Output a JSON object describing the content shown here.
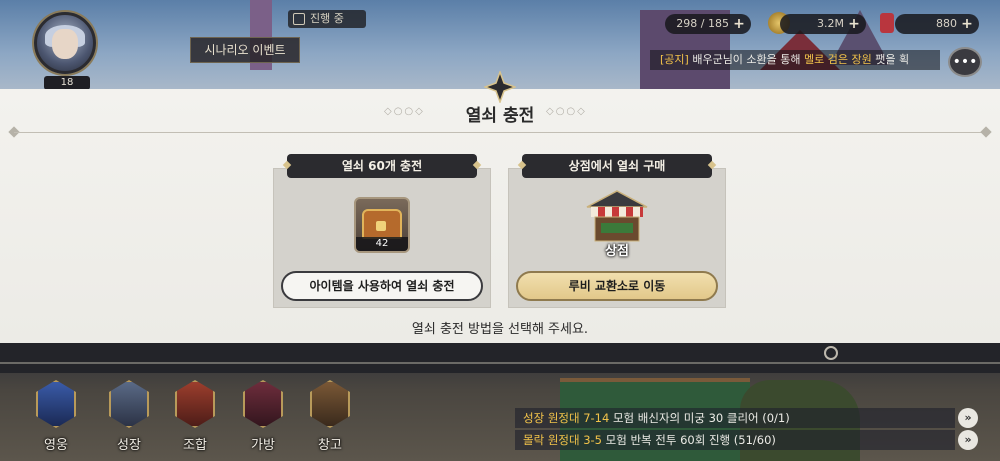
{
  "hud": {
    "player_level": "18",
    "scenario_event": "시나리오 이벤트",
    "progress_status": "진행 중",
    "energy": "298 / 185",
    "gold": "3.2M",
    "ruby": "880",
    "news_prefix": "[공지]",
    "news_text": "배우군님이 소환을 통해",
    "news_highlight": "멜로 검은 장원",
    "news_suffix": "팻을 획"
  },
  "popup": {
    "title": "열쇠 충전",
    "option_a": {
      "header": "열쇠 60개 충전",
      "item_count": "42",
      "button": "아이템을 사용하여 열쇠 충전"
    },
    "option_b": {
      "header": "상점에서 열쇠 구매",
      "icon_label": "상점",
      "button": "루비 교환소로 이동"
    },
    "instruction": "열쇠 충전 방법을 선택해 주세요."
  },
  "menu": {
    "items": [
      {
        "label": "영웅",
        "icon": "hero-emblem-icon"
      },
      {
        "label": "성장",
        "icon": "growth-emblem-icon"
      },
      {
        "label": "조합",
        "icon": "combine-emblem-icon"
      },
      {
        "label": "가방",
        "icon": "bag-emblem-icon"
      },
      {
        "label": "창고",
        "icon": "storage-emblem-icon"
      }
    ]
  },
  "quests": [
    {
      "tag": "성장 원정대 7-14",
      "text": "모험 배신자의 미궁 30 클리어 (0/1)"
    },
    {
      "tag": "몰락 원정대 3-5",
      "text": "모험 반복 전투 60회 진행 (51/60)"
    }
  ],
  "colors": {
    "accent_gold": "#e2c88a",
    "header_dark": "#2b2b2f",
    "highlight_text": "#f2c34a"
  }
}
